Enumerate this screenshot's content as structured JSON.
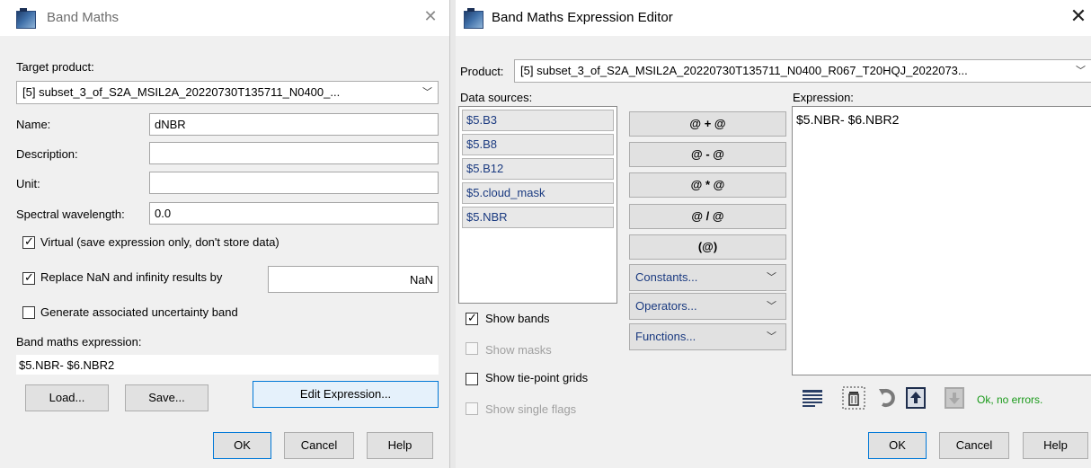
{
  "left_dialog": {
    "title": "Band Maths",
    "close_glyph": "✕",
    "target_product_label": "Target product:",
    "target_product_value": "[5] subset_3_of_S2A_MSIL2A_20220730T135711_N0400_...",
    "name_label": "Name:",
    "name_value": "dNBR",
    "description_label": "Description:",
    "description_value": "",
    "unit_label": "Unit:",
    "unit_value": "",
    "wavelength_label": "Spectral wavelength:",
    "wavelength_value": "0.0",
    "virtual_label": "Virtual (save expression only, don't store data)",
    "virtual_checked": true,
    "replace_label": "Replace NaN and infinity results by",
    "replace_checked": true,
    "replace_value": "NaN",
    "uncertainty_label": "Generate associated uncertainty band",
    "uncertainty_checked": false,
    "expression_label": "Band maths expression:",
    "expression_value": "$5.NBR- $6.NBR2",
    "load_button": "Load...",
    "save_button": "Save...",
    "edit_expression_button": "Edit Expression...",
    "ok_button": "OK",
    "cancel_button": "Cancel",
    "help_button": "Help"
  },
  "right_dialog": {
    "title": "Band Maths Expression Editor",
    "close_glyph": "✕",
    "product_label": "Product:",
    "product_value": "[5] subset_3_of_S2A_MSIL2A_20220730T135711_N0400_R067_T20HQJ_2022073...",
    "data_sources_label": "Data sources:",
    "data_sources": [
      "$5.B3",
      "$5.B8",
      "$5.B12",
      "$5.cloud_mask",
      "$5.NBR"
    ],
    "operator_buttons": [
      "@ + @",
      "@ - @",
      "@ * @",
      "@ / @",
      "(@)"
    ],
    "dropdown_buttons": [
      "Constants...",
      "Operators...",
      "Functions..."
    ],
    "expression_label": "Expression:",
    "expression_value": "$5.NBR- $6.NBR2",
    "show_bands_label": "Show bands",
    "show_bands_checked": true,
    "show_masks_label": "Show masks",
    "show_tiepoints_label": "Show tie-point grids",
    "show_single_flags_label": "Show single flags",
    "status_text": "Ok, no errors.",
    "status_color": "#1a9a1a",
    "ok_button": "OK",
    "cancel_button": "Cancel",
    "help_button": "Help"
  }
}
